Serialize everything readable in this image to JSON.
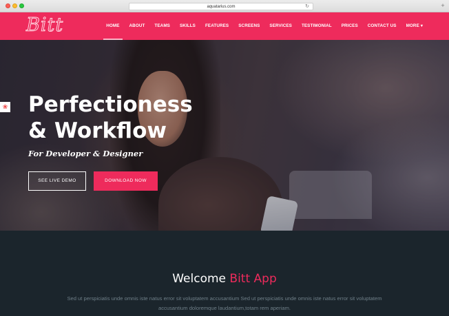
{
  "browser": {
    "url": "aquatarius.com"
  },
  "navbar": {
    "logo": "Bitt",
    "items": [
      {
        "label": "HOME",
        "active": true
      },
      {
        "label": "ABOUT"
      },
      {
        "label": "TEAMS"
      },
      {
        "label": "SKILLS"
      },
      {
        "label": "FEATURES"
      },
      {
        "label": "SCREENS"
      },
      {
        "label": "SERVICES"
      },
      {
        "label": "TESTIMONIAL"
      },
      {
        "label": "PRICES"
      },
      {
        "label": "CONTACT US"
      },
      {
        "label": "MORE"
      }
    ]
  },
  "hero": {
    "title_line1": "Perfectioness",
    "title_line2": "& Workflow",
    "subtitle": "For Developer & Designer",
    "demo_button": "SEE LIVE DEMO",
    "download_button": "DOWNLOAD NOW"
  },
  "welcome": {
    "title_main": "Welcome",
    "title_accent": "Bitt App",
    "text": "Sed ut perspiciatis unde omnis iste natus error sit voluptatem accusantium Sed ut perspiciatis unde omnis iste natus error sit voluptatem accusantium doloremque laudantium,totam rem aperiam."
  },
  "colors": {
    "accent": "#ee2b5c",
    "dark_section": "#1b252c"
  },
  "icons": {
    "widget": "color-wheel-icon",
    "more": "caret-down-icon"
  }
}
